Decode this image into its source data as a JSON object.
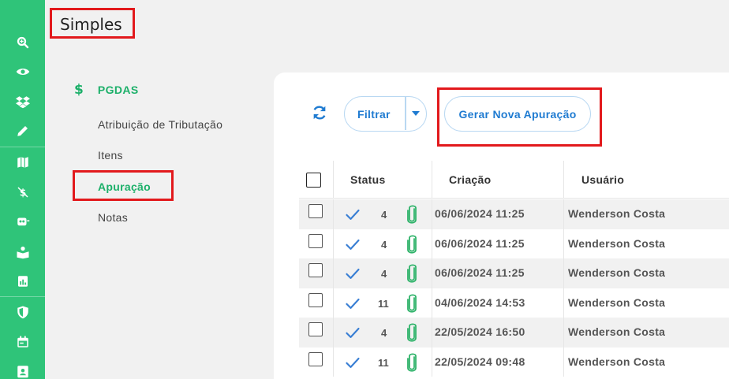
{
  "header": {
    "title": "Simples"
  },
  "rail": {
    "icons": [
      "search-icon",
      "eye-icon",
      "dropbox-icon",
      "pencil-icon",
      "map-icon",
      "no-dollar-icon",
      "robot-icon",
      "book-user-icon",
      "document-chart-icon",
      "shield-icon",
      "calendar-icon",
      "id-card-icon"
    ]
  },
  "menu": {
    "heading": "PGDAS",
    "heading_icon": "$",
    "items": [
      {
        "label": "Atribuição de Tributação"
      },
      {
        "label": "Itens"
      },
      {
        "label": "Apuração"
      },
      {
        "label": "Notas"
      }
    ],
    "active_index": 2
  },
  "toolbar": {
    "filter_label": "Filtrar",
    "generate_label": "Gerar Nova Apuração"
  },
  "table": {
    "columns": [
      "Status",
      "Criação",
      "Usuário"
    ],
    "rows": [
      {
        "count": "4",
        "created": "06/06/2024 11:25",
        "user": "Wenderson Costa"
      },
      {
        "count": "4",
        "created": "06/06/2024 11:25",
        "user": "Wenderson Costa"
      },
      {
        "count": "4",
        "created": "06/06/2024 11:25",
        "user": "Wenderson Costa"
      },
      {
        "count": "11",
        "created": "04/06/2024 14:53",
        "user": "Wenderson Costa"
      },
      {
        "count": "4",
        "created": "22/05/2024 16:50",
        "user": "Wenderson Costa"
      },
      {
        "count": "11",
        "created": "22/05/2024 09:48",
        "user": "Wenderson Costa"
      }
    ]
  },
  "colors": {
    "rail": "#2fc479",
    "accent": "#1db06a",
    "primary": "#1f7bd1",
    "highlight": "#e2191c"
  }
}
